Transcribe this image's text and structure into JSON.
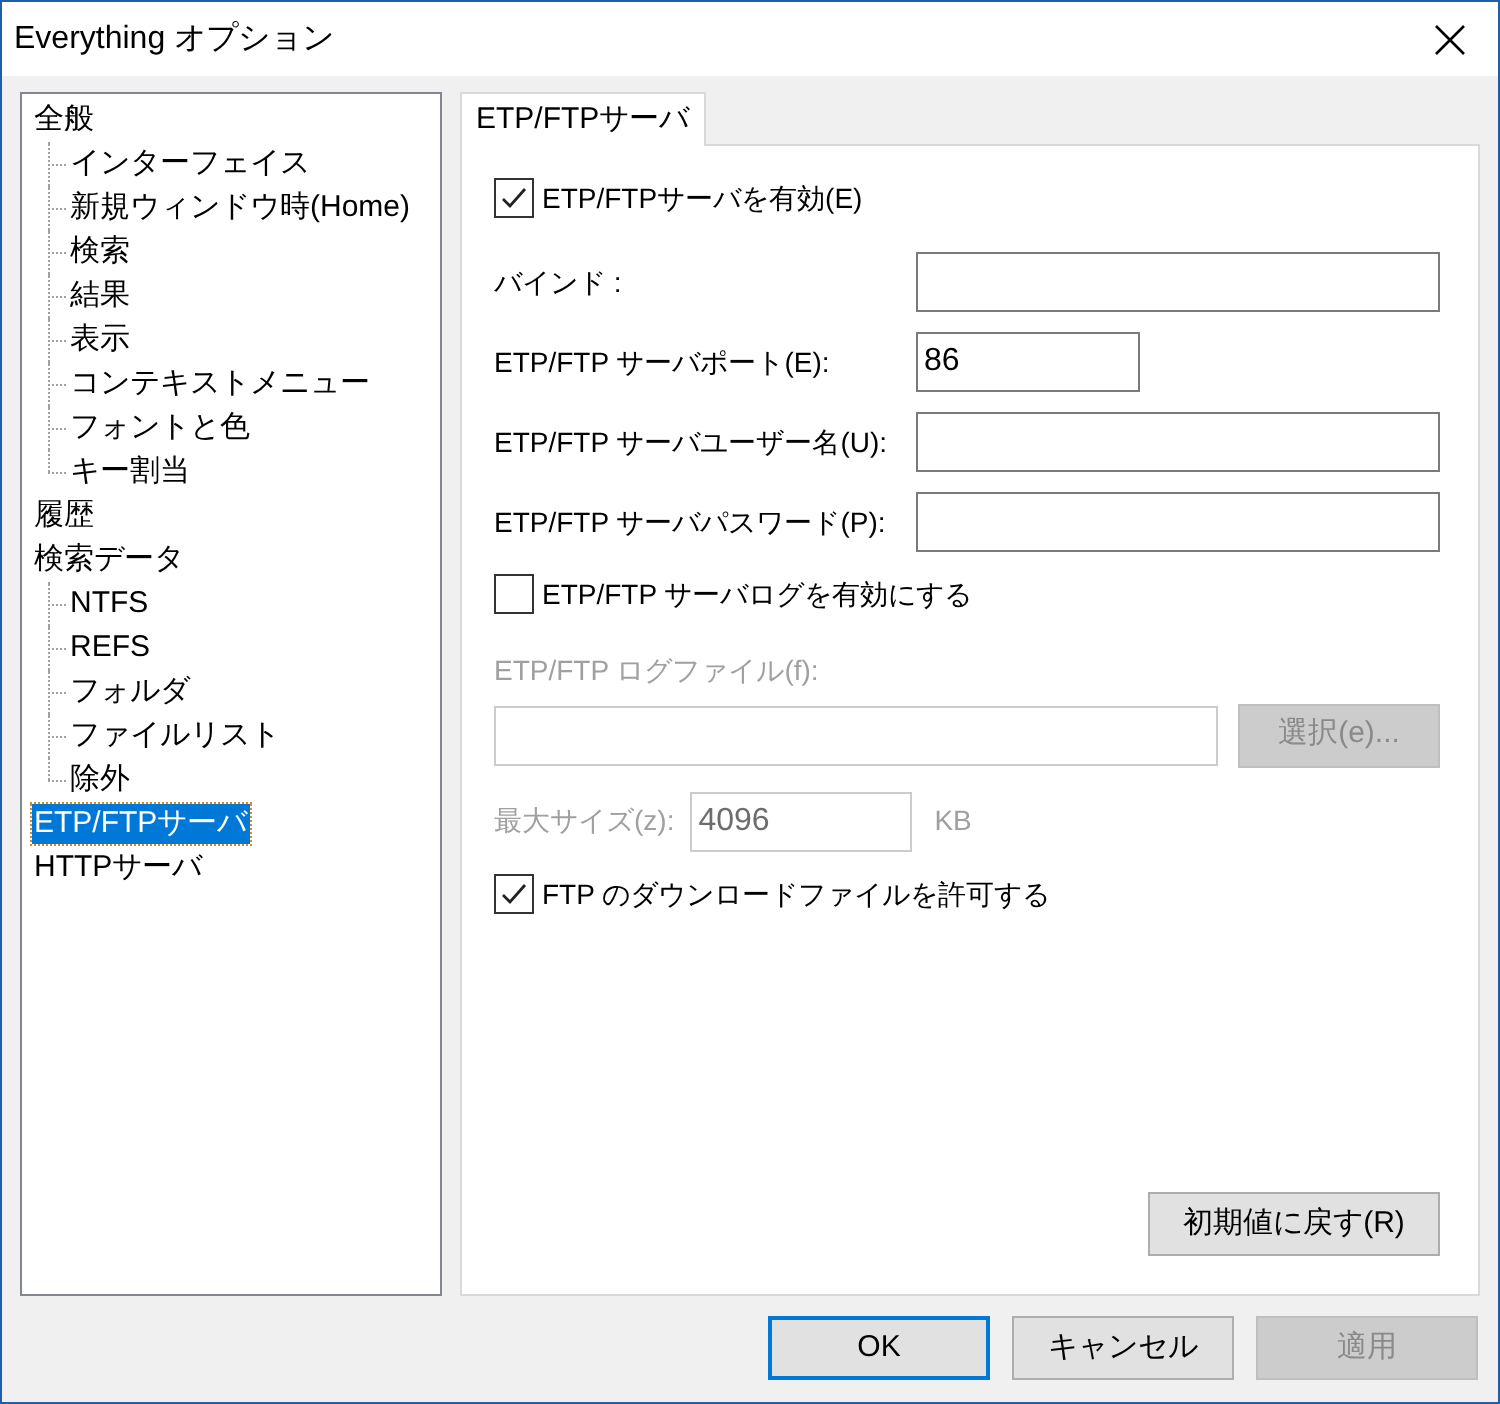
{
  "window": {
    "title": "Everything オプション"
  },
  "tree": [
    {
      "label": "全般",
      "selected": false,
      "children": [
        {
          "label": "インターフェイス",
          "selected": false
        },
        {
          "label": "新規ウィンドウ時(Home)",
          "selected": false
        },
        {
          "label": "検索",
          "selected": false
        },
        {
          "label": "結果",
          "selected": false
        },
        {
          "label": "表示",
          "selected": false
        },
        {
          "label": "コンテキストメニュー",
          "selected": false
        },
        {
          "label": "フォントと色",
          "selected": false
        },
        {
          "label": "キー割当",
          "selected": false
        }
      ]
    },
    {
      "label": "履歴",
      "selected": false
    },
    {
      "label": "検索データ",
      "selected": false,
      "children": [
        {
          "label": "NTFS",
          "selected": false
        },
        {
          "label": "REFS",
          "selected": false
        },
        {
          "label": "フォルダ",
          "selected": false
        },
        {
          "label": "ファイルリスト",
          "selected": false
        },
        {
          "label": "除外",
          "selected": false
        }
      ]
    },
    {
      "label": "ETP/FTPサーバ",
      "selected": true
    },
    {
      "label": "HTTPサーバ",
      "selected": false
    }
  ],
  "tabs": [
    {
      "label": "ETP/FTPサーバ",
      "selected": true
    }
  ],
  "form": [
    {
      "kind": "checkbox",
      "label": "ETP/FTPサーバを有効(E)",
      "checked": true
    },
    {
      "kind": "field",
      "label": "バインド :"
    },
    {
      "kind": "short_field",
      "label": "ETP/FTP サーバポート(E):",
      "value": "86"
    },
    {
      "kind": "field",
      "label": "ETP/FTP サーバユーザー名(U):"
    },
    {
      "kind": "field",
      "label": "ETP/FTP サーバパスワード(P):"
    },
    {
      "kind": "checkbox",
      "label": "ETP/FTP サーバログを有効にする",
      "checked": false
    },
    {
      "kind": "label",
      "label": "ETP/FTP ログファイル(f):",
      "disabled": true
    },
    {
      "kind": "browse",
      "button": "選択(e)...",
      "disabled": true
    },
    {
      "kind": "size",
      "label": "最大サイズ(z):",
      "value": "4096",
      "unit": "KB",
      "disabled": true
    },
    {
      "kind": "checkbox",
      "label": "FTP のダウンロードファイルを許可する",
      "checked": true
    }
  ],
  "reset_button": "初期値に戻す(R)",
  "buttons": [
    {
      "label": "OK",
      "default": true,
      "disabled": false
    },
    {
      "label": "キャンセル",
      "default": false,
      "disabled": false
    },
    {
      "label": "適用",
      "default": false,
      "disabled": true
    }
  ]
}
